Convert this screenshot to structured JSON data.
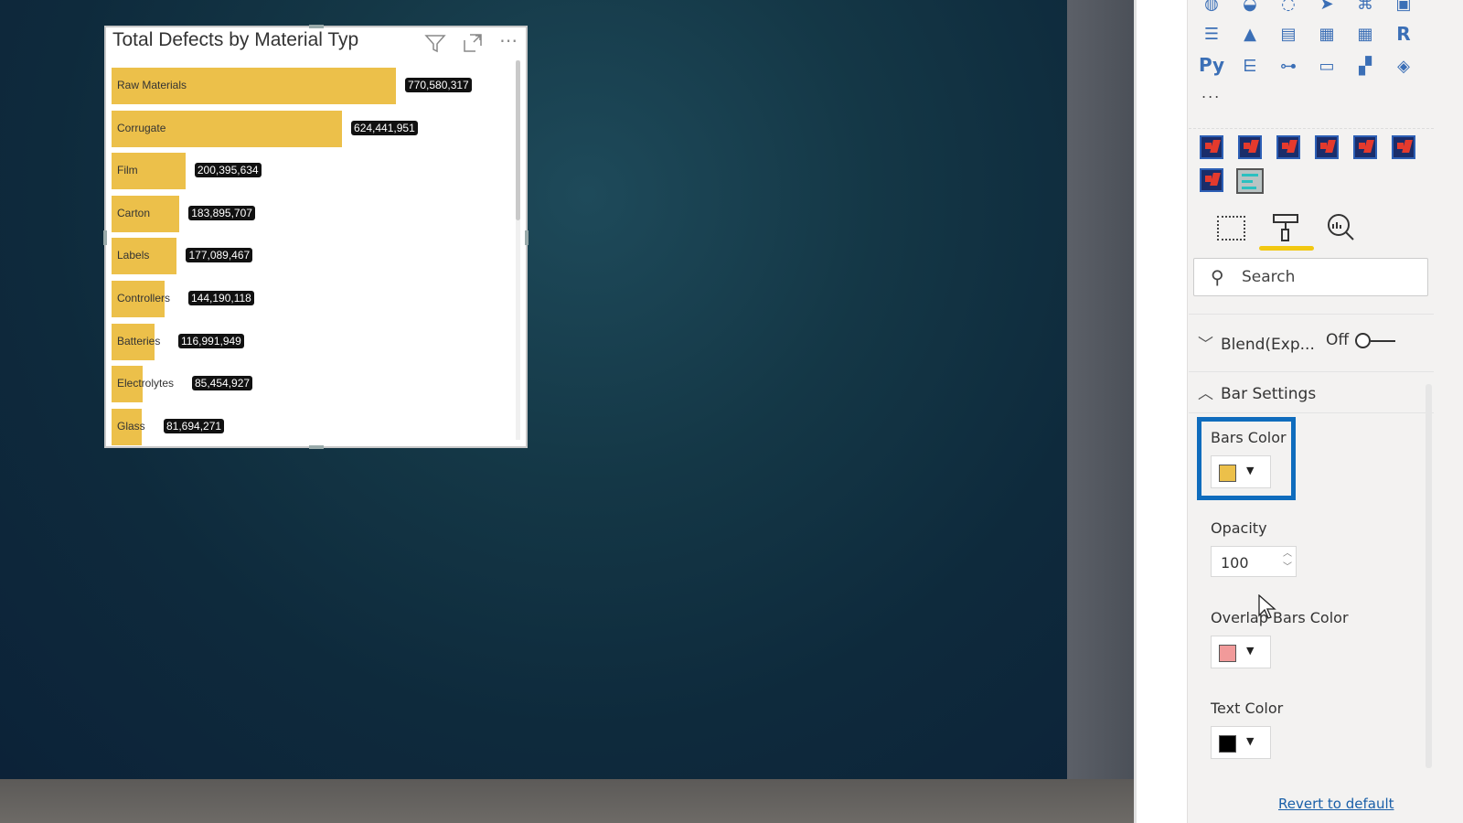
{
  "visual": {
    "title": "Total Defects by Material Typ",
    "icons": [
      "filter-icon",
      "focus-mode-icon",
      "more-options-icon"
    ],
    "more": "⋯"
  },
  "chart_data": {
    "type": "bar",
    "orientation": "horizontal",
    "title": "Total Defects by Material Typ",
    "categories": [
      "Raw Materials",
      "Corrugate",
      "Film",
      "Carton",
      "Labels",
      "Controllers",
      "Batteries",
      "Electrolytes",
      "Glass"
    ],
    "values": [
      770580317,
      624441951,
      200395634,
      183895707,
      177089467,
      144190118,
      116991949,
      85454927,
      81694271
    ],
    "labels": [
      "770,580,317",
      "624,441,951",
      "200,395,634",
      "183,895,707",
      "177,089,467",
      "144,190,118",
      "116,991,949",
      "85,454,927",
      "81,694,271"
    ],
    "bar_color": "#ecc04a",
    "label_bg": "#111111",
    "grid": false
  },
  "pane": {
    "visual_icons": {
      "r": "R",
      "py": "Py",
      "more": "..."
    },
    "search_placeholder": "Search",
    "blend": {
      "label": "Blend(Exp...",
      "state": "Off"
    },
    "bar_settings": {
      "label": "Bar Settings"
    },
    "bars_color": {
      "label": "Bars Color",
      "color": "#ecc04a"
    },
    "opacity": {
      "label": "Opacity",
      "value": "100"
    },
    "overlap_color": {
      "label": "Overlap Bars Color",
      "color": "#f19a9a"
    },
    "text_color": {
      "label": "Text Color",
      "color": "#000000"
    },
    "revert": "Revert to default"
  },
  "colors": {
    "accent": "#0f6cbd",
    "tab_underline": "#f2c811"
  }
}
